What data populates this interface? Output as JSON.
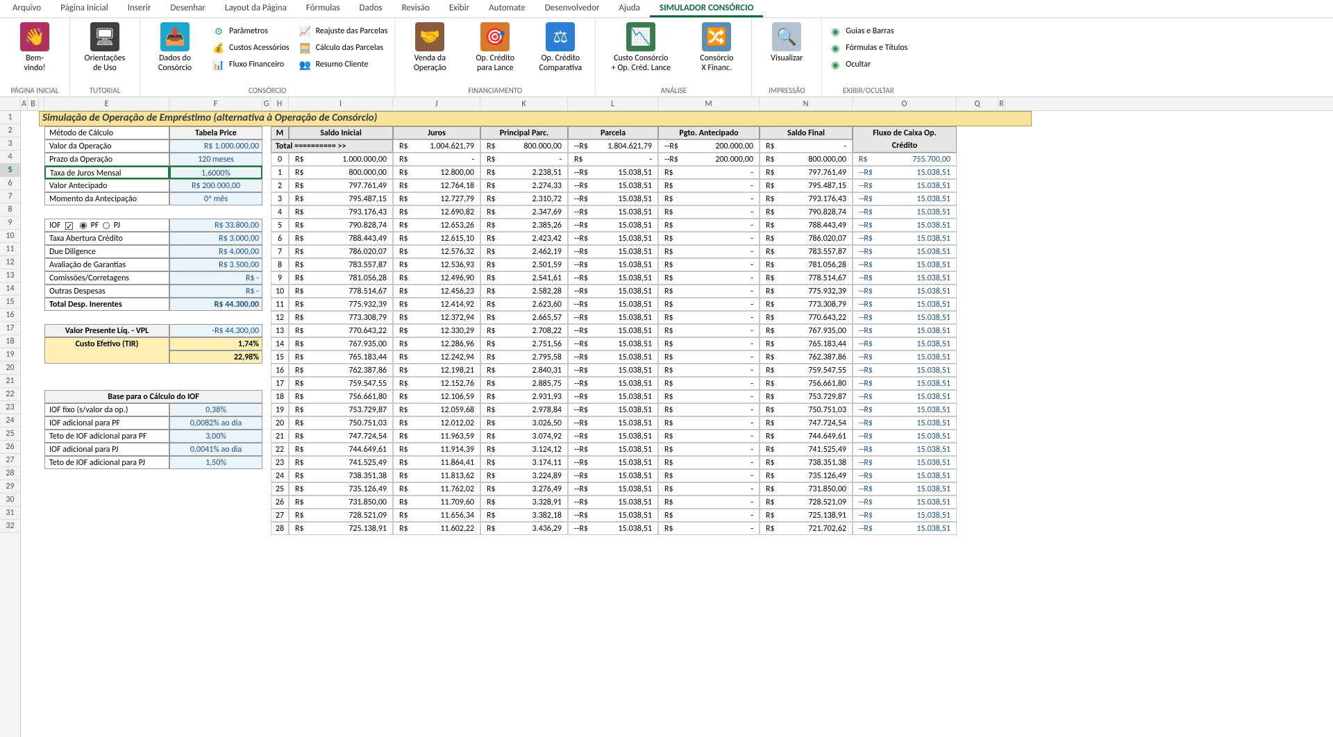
{
  "ribbon_tabs": [
    "Arquivo",
    "Página Inicial",
    "Inserir",
    "Desenhar",
    "Layout da Página",
    "Fórmulas",
    "Dados",
    "Revisão",
    "Exibir",
    "Automate",
    "Desenvolvedor",
    "Ajuda",
    "SIMULADOR CONSÓRCIO"
  ],
  "ribbon_groups": {
    "pagina_inicial": {
      "title": "PÁGINA INICIAL",
      "bemvindo": "Bem-\nvindo!"
    },
    "tutorial": {
      "title": "TUTORIAL",
      "orientacoes": "Orientações\nde Uso"
    },
    "consorcio": {
      "title": "CONSÓRCIO",
      "dados": "Dados do\nConsórcio",
      "parametros": "Parâmetros",
      "custos": "Custos Acessórios",
      "fluxo": "Fluxo Financeiro",
      "reajuste": "Reajuste das Parcelas",
      "calculo": "Cálculo das Parcelas",
      "resumo": "Resumo Cliente"
    },
    "financiamento": {
      "title": "FINANCIAMENTO",
      "venda": "Venda da\nOperação",
      "lance": "Op. Crédito\npara Lance",
      "comparativa": "Op. Crédito\nComparativa"
    },
    "analise": {
      "title": "ANÁLISE",
      "custo": "Custo Consórcio\n+ Op. Créd. Lance",
      "xfin": "Consórcio\nX Financ."
    },
    "impressao": {
      "title": "IMPRESSÃO",
      "visualizar": "Visualizar"
    },
    "exibir": {
      "title": "EXIBIR/OCULTAR",
      "guias": "Guias e Barras",
      "formulas": "Fórmulas e Títulos",
      "ocultar": "Ocultar"
    }
  },
  "column_letters": [
    "A",
    "B",
    "",
    "E",
    "F",
    "G",
    "H",
    "I",
    "J",
    "K",
    "L",
    "M",
    "N",
    "O",
    "Q",
    "R"
  ],
  "title": "Simulação de Operação de Empréstimo (alternativa à Operação de Consórcio)",
  "inputs": {
    "metodo_lbl": "Método de Cálculo",
    "metodo_val": "Tabela Price",
    "valor_lbl": "Valor da Operação",
    "valor_val": "R$     1.000.000,00",
    "prazo_lbl": "Prazo da Operação",
    "prazo_val": "120 meses",
    "taxa_lbl": "Taxa de Juros Mensal",
    "taxa_val": "1,6000%",
    "antec_lbl": "Valor Antecipado",
    "antec_val": "R$        200.000,00",
    "momento_lbl": "Momento da Antecipação",
    "momento_val": "0º mês"
  },
  "despesas": {
    "iof_lbl": "IOF",
    "pf": "PF",
    "pj": "PJ",
    "iof_val": "R$           33.800,00",
    "tac_lbl": "Taxa Abertura Crédito",
    "tac_val": "R$             3.000,00",
    "dd_lbl": "Due Diligence",
    "dd_val": "R$             4.000,00",
    "gar_lbl": "Avaliação de Garantias",
    "gar_val": "R$             3.500,00",
    "com_lbl": "Comissões/Corretagens",
    "com_val": "R$                        -",
    "out_lbl": "Outras Despesas",
    "out_val": "R$                        -",
    "tot_lbl": "Total Desp. Inerentes",
    "tot_val": "R$           44.300,00"
  },
  "resultados": {
    "vpl_lbl": "Valor Presente Líq. - VPL",
    "vpl_val": "-R$           44.300,00",
    "tir_lbl": "Custo Efetivo (TIR)",
    "tir_mensal": "1,74%",
    "tir_anual": "22,98%"
  },
  "iof_box": {
    "titulo": "Base para o Cálculo do IOF",
    "l1": "IOF fixo (s/valor da op.)",
    "v1": "0,38%",
    "l2": "IOF adicional para PF",
    "v2": "0,0082% ao dia",
    "l3": "Teto de IOF adicional para PF",
    "v3": "3,00%",
    "l4": "IOF adicional para PJ",
    "v4": "0,0041% ao dia",
    "l5": "Teto de IOF adicional para PJ",
    "v5": "1,50%"
  },
  "table_headers": {
    "m": "M",
    "saldo_ini": "Saldo Inicial",
    "juros": "Juros",
    "principal": "Principal Parc.",
    "parcela": "Parcela",
    "pgto": "Pgto. Antecipado",
    "saldo_fin": "Saldo Final",
    "fluxo": "Fluxo de Caixa Op.\nCrédito"
  },
  "totais": {
    "label": "Total ========== >>",
    "juros": "1.004.621,79",
    "principal": "800.000,00",
    "parcela": "1.804.621,79",
    "pgto": "200.000,00",
    "saldo_fin": "-"
  },
  "rows": [
    {
      "m": 0,
      "si": "1.000.000,00",
      "j": "-",
      "pp": "-",
      "pa": "-",
      "pg": "200.000,00",
      "sf": "800.000,00",
      "fx": "755.700,00",
      "fxpos": true
    },
    {
      "m": 1,
      "si": "800.000,00",
      "j": "12.800,00",
      "pp": "2.238,51",
      "pa": "15.038,51",
      "pg": "-",
      "sf": "797.761,49",
      "fx": "15.038,51"
    },
    {
      "m": 2,
      "si": "797.761,49",
      "j": "12.764,18",
      "pp": "2.274,33",
      "pa": "15.038,51",
      "pg": "-",
      "sf": "795.487,15",
      "fx": "15.038,51"
    },
    {
      "m": 3,
      "si": "795.487,15",
      "j": "12.727,79",
      "pp": "2.310,72",
      "pa": "15.038,51",
      "pg": "-",
      "sf": "793.176,43",
      "fx": "15.038,51"
    },
    {
      "m": 4,
      "si": "793.176,43",
      "j": "12.690,82",
      "pp": "2.347,69",
      "pa": "15.038,51",
      "pg": "-",
      "sf": "790.828,74",
      "fx": "15.038,51"
    },
    {
      "m": 5,
      "si": "790.828,74",
      "j": "12.653,26",
      "pp": "2.385,26",
      "pa": "15.038,51",
      "pg": "-",
      "sf": "788.443,49",
      "fx": "15.038,51"
    },
    {
      "m": 6,
      "si": "788.443,49",
      "j": "12.615,10",
      "pp": "2.423,42",
      "pa": "15.038,51",
      "pg": "-",
      "sf": "786.020,07",
      "fx": "15.038,51"
    },
    {
      "m": 7,
      "si": "786.020,07",
      "j": "12.576,32",
      "pp": "2.462,19",
      "pa": "15.038,51",
      "pg": "-",
      "sf": "783.557,87",
      "fx": "15.038,51"
    },
    {
      "m": 8,
      "si": "783.557,87",
      "j": "12.536,93",
      "pp": "2.501,59",
      "pa": "15.038,51",
      "pg": "-",
      "sf": "781.056,28",
      "fx": "15.038,51"
    },
    {
      "m": 9,
      "si": "781.056,28",
      "j": "12.496,90",
      "pp": "2.541,61",
      "pa": "15.038,51",
      "pg": "-",
      "sf": "778.514,67",
      "fx": "15.038,51"
    },
    {
      "m": 10,
      "si": "778.514,67",
      "j": "12.456,23",
      "pp": "2.582,28",
      "pa": "15.038,51",
      "pg": "-",
      "sf": "775.932,39",
      "fx": "15.038,51"
    },
    {
      "m": 11,
      "si": "775.932,39",
      "j": "12.414,92",
      "pp": "2.623,60",
      "pa": "15.038,51",
      "pg": "-",
      "sf": "773.308,79",
      "fx": "15.038,51"
    },
    {
      "m": 12,
      "si": "773.308,79",
      "j": "12.372,94",
      "pp": "2.665,57",
      "pa": "15.038,51",
      "pg": "-",
      "sf": "770.643,22",
      "fx": "15.038,51"
    },
    {
      "m": 13,
      "si": "770.643,22",
      "j": "12.330,29",
      "pp": "2.708,22",
      "pa": "15.038,51",
      "pg": "-",
      "sf": "767.935,00",
      "fx": "15.038,51"
    },
    {
      "m": 14,
      "si": "767.935,00",
      "j": "12.286,96",
      "pp": "2.751,56",
      "pa": "15.038,51",
      "pg": "-",
      "sf": "765.183,44",
      "fx": "15.038,51"
    },
    {
      "m": 15,
      "si": "765.183,44",
      "j": "12.242,94",
      "pp": "2.795,58",
      "pa": "15.038,51",
      "pg": "-",
      "sf": "762.387,86",
      "fx": "15.038,51"
    },
    {
      "m": 16,
      "si": "762.387,86",
      "j": "12.198,21",
      "pp": "2.840,31",
      "pa": "15.038,51",
      "pg": "-",
      "sf": "759.547,55",
      "fx": "15.038,51"
    },
    {
      "m": 17,
      "si": "759.547,55",
      "j": "12.152,76",
      "pp": "2.885,75",
      "pa": "15.038,51",
      "pg": "-",
      "sf": "756.661,80",
      "fx": "15.038,51"
    },
    {
      "m": 18,
      "si": "756.661,80",
      "j": "12.106,59",
      "pp": "2.931,93",
      "pa": "15.038,51",
      "pg": "-",
      "sf": "753.729,87",
      "fx": "15.038,51"
    },
    {
      "m": 19,
      "si": "753.729,87",
      "j": "12.059,68",
      "pp": "2.978,84",
      "pa": "15.038,51",
      "pg": "-",
      "sf": "750.751,03",
      "fx": "15.038,51"
    },
    {
      "m": 20,
      "si": "750.751,03",
      "j": "12.012,02",
      "pp": "3.026,50",
      "pa": "15.038,51",
      "pg": "-",
      "sf": "747.724,54",
      "fx": "15.038,51"
    },
    {
      "m": 21,
      "si": "747.724,54",
      "j": "11.963,59",
      "pp": "3.074,92",
      "pa": "15.038,51",
      "pg": "-",
      "sf": "744.649,61",
      "fx": "15.038,51"
    },
    {
      "m": 22,
      "si": "744.649,61",
      "j": "11.914,39",
      "pp": "3.124,12",
      "pa": "15.038,51",
      "pg": "-",
      "sf": "741.525,49",
      "fx": "15.038,51"
    },
    {
      "m": 23,
      "si": "741.525,49",
      "j": "11.864,41",
      "pp": "3.174,11",
      "pa": "15.038,51",
      "pg": "-",
      "sf": "738.351,38",
      "fx": "15.038,51"
    },
    {
      "m": 24,
      "si": "738.351,38",
      "j": "11.813,62",
      "pp": "3.224,89",
      "pa": "15.038,51",
      "pg": "-",
      "sf": "735.126,49",
      "fx": "15.038,51"
    },
    {
      "m": 25,
      "si": "735.126,49",
      "j": "11.762,02",
      "pp": "3.276,49",
      "pa": "15.038,51",
      "pg": "-",
      "sf": "731.850,00",
      "fx": "15.038,51"
    },
    {
      "m": 26,
      "si": "731.850,00",
      "j": "11.709,60",
      "pp": "3.328,91",
      "pa": "15.038,51",
      "pg": "-",
      "sf": "728.521,09",
      "fx": "15.038,51"
    },
    {
      "m": 27,
      "si": "728.521,09",
      "j": "11.656,34",
      "pp": "3.382,18",
      "pa": "15.038,51",
      "pg": "-",
      "sf": "725.138,91",
      "fx": "15.038,51"
    },
    {
      "m": 28,
      "si": "725.138,91",
      "j": "11.602,22",
      "pp": "3.436,29",
      "pa": "15.038,51",
      "pg": "-",
      "sf": "721.702,62",
      "fx": "15.038,51"
    }
  ]
}
